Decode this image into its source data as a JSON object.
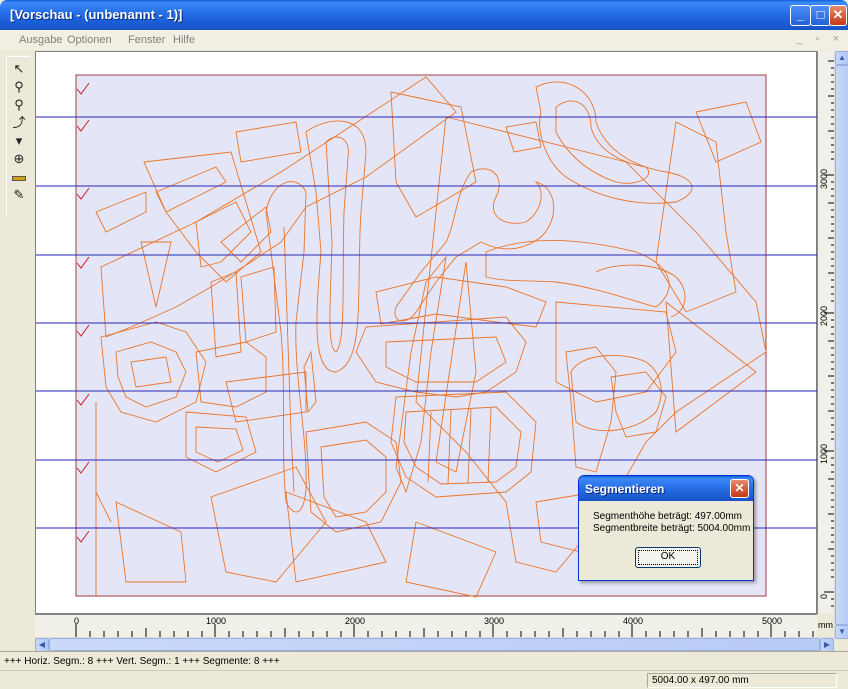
{
  "window": {
    "title": "[Vorschau - (unbenannt - 1)]",
    "minimize": "_",
    "maximize": "□",
    "close": "✕"
  },
  "menu": {
    "items": [
      "Ausgabe",
      "Optionen",
      "Fenster",
      "Hilfe"
    ],
    "mdi_controls": "_ ▫ ×"
  },
  "toolbar": {
    "tools": [
      "select-icon",
      "zoom-in-icon",
      "zoom-out-icon",
      "pan-icon",
      "stamp-icon",
      "magnifier-icon",
      "ruler-icon",
      "pipette-icon"
    ]
  },
  "canvas": {
    "background_color": "#e5e5f8",
    "outline_color": "#e8762a",
    "segment_line_color": "#2626b8",
    "segment_count": 8
  },
  "rulers": {
    "horizontal_labels": [
      "0",
      "1000",
      "2000",
      "3000",
      "4000",
      "5000"
    ],
    "vertical_labels": [
      "3000",
      "2000",
      "1000",
      "0"
    ],
    "unit": "mm"
  },
  "status": {
    "segments": "+++ Horiz. Segm.: 8 +++ Vert. Segm.: 1 +++ Segmente: 8 +++",
    "dimensions": "5004.00 x 497.00 mm"
  },
  "dialog": {
    "title": "Segmentieren",
    "line1": "Segmenthöhe beträgt: 497.00mm",
    "line2": "Segmentbreite beträgt: 5004.00mm",
    "ok_label": "OK",
    "close": "✕"
  }
}
